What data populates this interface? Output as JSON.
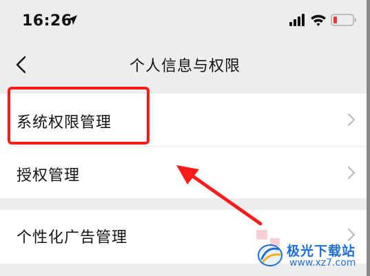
{
  "status_bar": {
    "time": "16:26",
    "icons": [
      "location-arrow-icon",
      "cellular-signal-icon",
      "wifi-icon",
      "battery-low-icon"
    ]
  },
  "nav": {
    "title": "个人信息与权限",
    "back_icon": "chevron-left-icon"
  },
  "groups": [
    {
      "items": [
        {
          "label": "系统权限管理",
          "icon": "chevron-right-icon",
          "highlighted": true
        },
        {
          "label": "授权管理",
          "icon": "chevron-right-icon"
        }
      ]
    },
    {
      "items": [
        {
          "label": "个性化广告管理",
          "icon": "chevron-right-icon"
        }
      ]
    }
  ],
  "annotation": {
    "highlight_color": "#ff1a1a",
    "arrow_color": "#ff1a1a",
    "arrow_points_to": "系统权限管理"
  },
  "watermark": {
    "title": "极光下载站",
    "url": "www.xz7.com",
    "color": "#1f6ed4"
  },
  "colors": {
    "background": "#ededed",
    "list_bg": "#ffffff",
    "battery_low": "#e53935"
  }
}
